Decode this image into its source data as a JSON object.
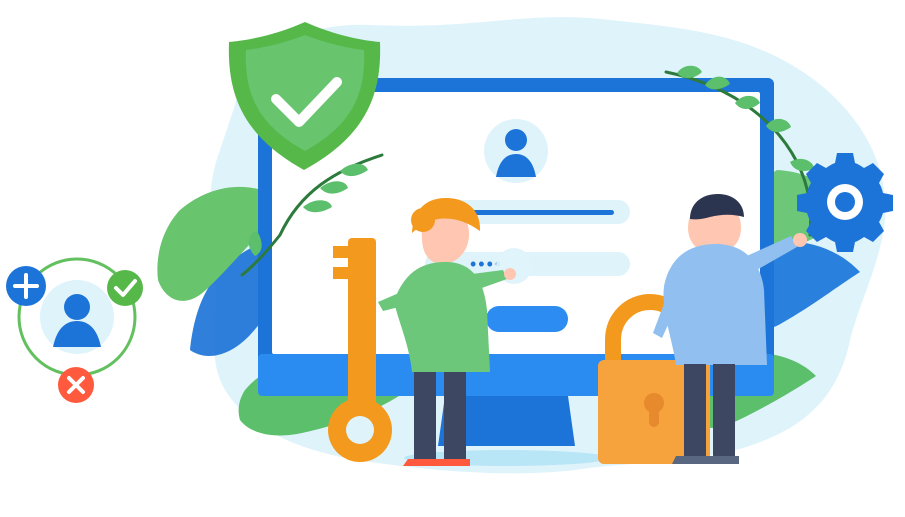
{
  "illustration": {
    "subject": "secure-login-access-control",
    "password_mask": "••••",
    "palette": {
      "background_blob": "#dff3fb",
      "screen_frame": "#1d74d8",
      "screen_face": "#ffffff",
      "accent_blue": "#2c8cf2",
      "shield_green": "#57b84a",
      "leaf_green": "#68c46d",
      "key_orange": "#f39a1e",
      "lock_orange": "#f7a33d",
      "error_red": "#ff5a3d",
      "person_skin": "#ffc7b1"
    },
    "icons": [
      "shield-check-icon",
      "user-avatar-icon",
      "key-icon",
      "padlock-icon",
      "gear-icon",
      "add-icon",
      "check-icon",
      "close-icon"
    ]
  }
}
